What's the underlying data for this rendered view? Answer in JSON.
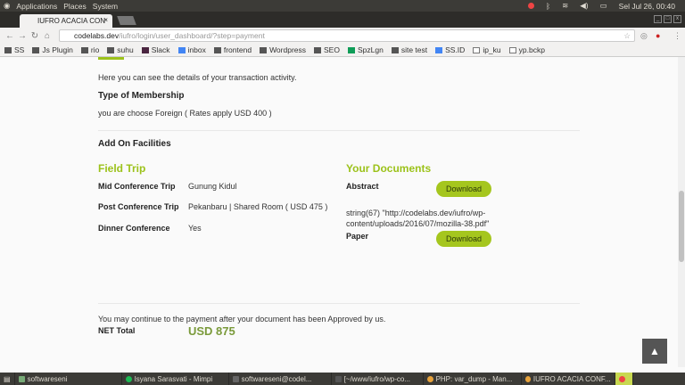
{
  "system_bar": {
    "menus": [
      "Applications",
      "Places",
      "System"
    ],
    "clock": "Sel Jul 26, 00:40"
  },
  "browser": {
    "tab_title": "IUFRO ACACIA CON",
    "tab_close": "×",
    "url_host": "codelabs.dev",
    "url_path": "/iufro/login/user_dashboard/?step=payment",
    "bookmarks": [
      "SS",
      "Js Plugin",
      "rio",
      "suhu",
      "Slack",
      "inbox",
      "frontend",
      "Wordpress",
      "SEO",
      "SpzLgn",
      "site test",
      "SS.ID",
      "ip_ku",
      "yp.bckp"
    ]
  },
  "page": {
    "intro": "Here you can see the details of your transaction activity.",
    "membership_heading": "Type of Membership",
    "membership_text": "you are choose Foreign ( Rates apply USD 400 )",
    "addon_heading": "Add On Facilities",
    "field_trip": {
      "heading": "Field Trip",
      "rows": [
        {
          "label": "Mid Conference Trip",
          "value": "Gunung Kidul"
        },
        {
          "label": "Post Conference Trip",
          "value": "Pekanbaru | Shared Room ( USD 475 )"
        },
        {
          "label": "Dinner Conference",
          "value": "Yes"
        }
      ]
    },
    "documents": {
      "heading": "Your Documents",
      "abstract_label": "Abstract",
      "download_label": "Download",
      "debug_line1": "string(67) \"http://codelabs.dev/iufro/wp-",
      "debug_line2": "content/uploads/2016/07/mozilla-38.pdf\"",
      "paper_label": "Paper"
    },
    "payment_note": "You may continue to the payment after your document has been Approved by us.",
    "net_total_label": "NET Total",
    "net_total_value": "USD 875",
    "scroll_top": "▲"
  },
  "taskbar": {
    "items": [
      "softwareseni",
      "Isyana Sarasvati - Mimpi",
      "softwareseni@codel...",
      "[~/www/iufro/wp-co...",
      "PHP: var_dump - Man...",
      "IUFRO ACACIA CONF..."
    ]
  },
  "colors": {
    "accent": "#9cc21a"
  }
}
